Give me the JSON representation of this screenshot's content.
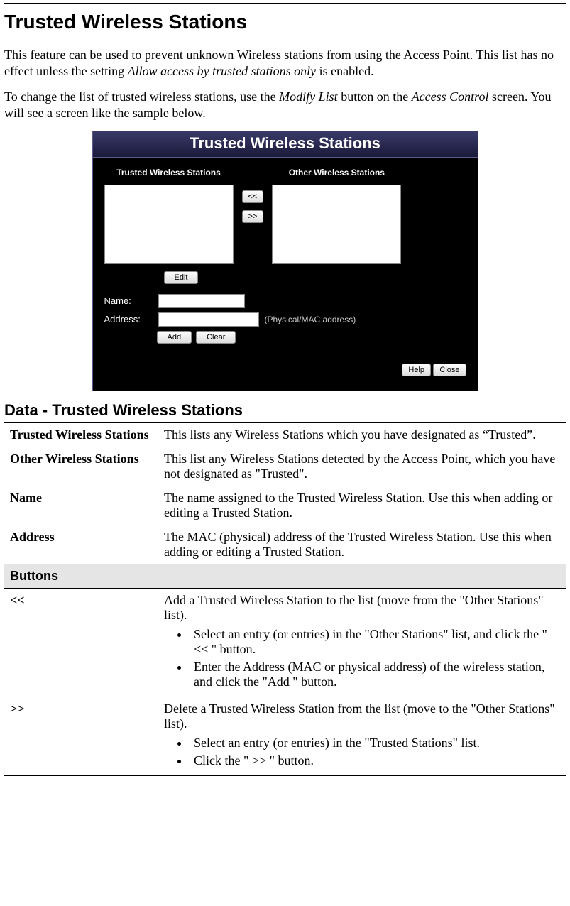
{
  "headings": {
    "main": "Trusted Wireless Stations",
    "data_section": "Data - Trusted Wireless Stations"
  },
  "paragraphs": {
    "p1_a": "This feature can be used to prevent unknown Wireless stations from using the Access Point. This list has no effect unless the setting ",
    "p1_i": "Allow access by trusted stations only",
    "p1_b": " is enabled.",
    "p2_a": "To change the list of trusted wireless stations, use the ",
    "p2_i1": "Modify List",
    "p2_b": " button on the ",
    "p2_i2": "Access Control",
    "p2_c": " screen. You will see a screen like the sample below."
  },
  "embed": {
    "title": "Trusted Wireless Stations",
    "left_label": "Trusted Wireless Stations",
    "right_label": "Other Wireless Stations",
    "btn_left": "<<",
    "btn_right": ">>",
    "btn_edit": "Edit",
    "lbl_name": "Name:",
    "lbl_address": "Address:",
    "hint_address": "(Physical/MAC address)",
    "btn_add": "Add",
    "btn_clear": "Clear",
    "btn_help": "Help",
    "btn_close": "Close"
  },
  "table": {
    "rows": [
      {
        "key": "Trusted Wireless Stations",
        "val": "This lists any Wireless Stations which you have designated as “Trusted”."
      },
      {
        "key": "Other Wireless Stations",
        "val": "This list any Wireless Stations detected by the Access Point, which you have not designated as \"Trusted\"."
      },
      {
        "key": "Name",
        "val": "The name assigned to the Trusted Wireless Station. Use this when adding or editing a Trusted Station."
      },
      {
        "key": "Address",
        "val": "The MAC (physical) address of the Trusted Wireless Station. Use this when adding or editing a Trusted Station."
      }
    ],
    "section_buttons": "Buttons",
    "brows": [
      {
        "key": "<<",
        "lead": "Add a Trusted Wireless Station to the list (move from the \"Other Stations\" list).",
        "bullets": [
          "Select an entry (or entries) in the \"Other Stations\" list, and click the \" << \" button.",
          "Enter the Address (MAC or physical address) of the wireless station, and click the \"Add \" button."
        ]
      },
      {
        "key": ">>",
        "lead": "Delete a Trusted Wireless Station from the list (move to the \"Other Stations\" list).",
        "bullets": [
          "Select an entry (or entries) in the \"Trusted Stations\" list.",
          "Click the \" >> \" button."
        ]
      }
    ]
  }
}
